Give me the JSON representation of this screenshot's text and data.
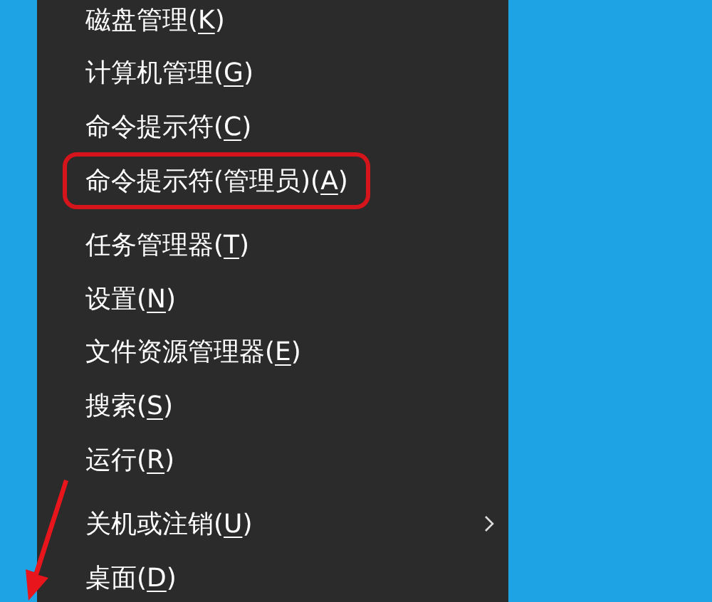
{
  "menu": {
    "sections": [
      {
        "items": [
          {
            "prefix": "磁盘管理(",
            "key": "K",
            "suffix": ")",
            "highlighted": false,
            "submenu": false
          },
          {
            "prefix": "计算机管理(",
            "key": "G",
            "suffix": ")",
            "highlighted": false,
            "submenu": false
          },
          {
            "prefix": "命令提示符(",
            "key": "C",
            "suffix": ")",
            "highlighted": false,
            "submenu": false
          },
          {
            "prefix": "命令提示符(管理员)(",
            "key": "A",
            "suffix": ")",
            "highlighted": true,
            "submenu": false
          }
        ]
      },
      {
        "items": [
          {
            "prefix": "任务管理器(",
            "key": "T",
            "suffix": ")",
            "highlighted": false,
            "submenu": false
          },
          {
            "prefix": "设置(",
            "key": "N",
            "suffix": ")",
            "highlighted": false,
            "submenu": false
          },
          {
            "prefix": "文件资源管理器(",
            "key": "E",
            "suffix": ")",
            "highlighted": false,
            "submenu": false
          },
          {
            "prefix": "搜索(",
            "key": "S",
            "suffix": ")",
            "highlighted": false,
            "submenu": false
          },
          {
            "prefix": "运行(",
            "key": "R",
            "suffix": ")",
            "highlighted": false,
            "submenu": false
          }
        ]
      },
      {
        "items": [
          {
            "prefix": "关机或注销(",
            "key": "U",
            "suffix": ")",
            "highlighted": false,
            "submenu": true
          },
          {
            "prefix": "桌面(",
            "key": "D",
            "suffix": ")",
            "highlighted": false,
            "submenu": false
          }
        ]
      }
    ]
  }
}
